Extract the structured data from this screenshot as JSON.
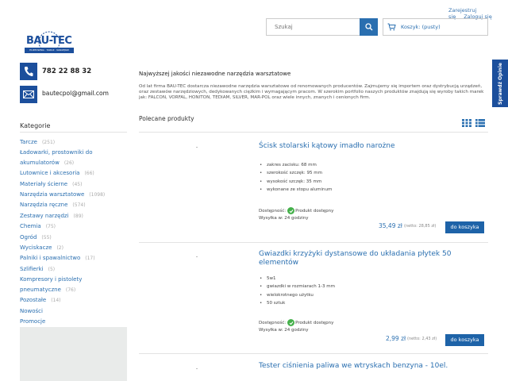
{
  "header": {
    "register": "Zarejestruj się",
    "login": "Zaloguj się",
    "search_placeholder": "Szukaj",
    "cart_label": "Koszyk: (pusty)"
  },
  "logo": {
    "name": "BAU-TEC",
    "tagline": "HURTOWNIA · TARCZ · NARZĘDZI"
  },
  "contact": {
    "phone": "782 22 88 32",
    "email": "bautecpol@gmail.com"
  },
  "sidebar": {
    "title": "Kategorie",
    "items": [
      {
        "label": "Tarcze",
        "count": "(251)"
      },
      {
        "label": "Ładowarki, prostowniki do akumulatorów",
        "count": "(26)"
      },
      {
        "label": "Lutownice i akcesoria",
        "count": "(66)"
      },
      {
        "label": "Materiały ścierne",
        "count": "(45)"
      },
      {
        "label": "Narzędzia warsztatowe",
        "count": "(1098)"
      },
      {
        "label": "Narzędzia ręczne",
        "count": "(574)"
      },
      {
        "label": "Zestawy narzędzi",
        "count": "(89)"
      },
      {
        "label": "Chemia",
        "count": "(75)"
      },
      {
        "label": "Ogród",
        "count": "(55)"
      },
      {
        "label": "Wyciskacze",
        "count": "(2)"
      },
      {
        "label": "Palniki i spawalnictwo",
        "count": "(17)"
      },
      {
        "label": "Szlifierki",
        "count": "(5)"
      },
      {
        "label": "Kompresory i pistolety pneumatyczne",
        "count": "(76)"
      },
      {
        "label": "Pozostałe",
        "count": "(14)"
      },
      {
        "label": "Nowości",
        "count": ""
      },
      {
        "label": "Promocje",
        "count": ""
      }
    ]
  },
  "intro": {
    "title": "Najwyższej jakości niezawodne narzędzia warsztatowe",
    "text": "Od lat firma BAU-TEC dostarcza niezawodne narzędzia warsztatowe od renomowanych producentów. Zajmujemy się importem oraz dystrybucją urządzeń, oraz zestawów narzędziowych, dedykowanych ciężkim i wymagającym pracom. W szerokim portfolio naszych produktów znajdują się wyroby takich marek jak: FALCON, VORFAL, HONITON, TEDIAM, SILVER, MAR-POL oraz wiele innych, znanych i cenionych firm."
  },
  "featured": {
    "title": "Polecane produkty"
  },
  "products": [
    {
      "name": "Ścisk stolarski kątowy imadło narożne",
      "features": [
        "zakres zacisku: 68 mm",
        "szerokość szczęk: 95 mm",
        "wysokość szczęk: 35 mm",
        "wykonane ze stopu aluminum"
      ],
      "availability_label": "Dostępność:",
      "availability": "Produkt dostępny",
      "shipping": "Wysyłka w: 24 godziny",
      "price": "35,49 zł",
      "net_price": "(netto: 28,85 zł)",
      "cart_button": "do koszyka"
    },
    {
      "name": "Gwiazdki krzyżyki dystansowe do układania płytek 50 elementów",
      "features": [
        "5w1",
        "gwiazdki w rozmiarach 1-3 mm",
        "wielokrotnego użytku",
        "50 sztuk"
      ],
      "availability_label": "Dostępność:",
      "availability": "Produkt dostępny",
      "shipping": "Wysyłka w: 24 godziny",
      "price": "2,99 zł",
      "net_price": "(netto: 2,43 zł)",
      "cart_button": "do koszyka"
    },
    {
      "name": "Tester ciśnienia paliwa we wtryskach benzyna - 10el."
    }
  ],
  "side_tab": {
    "label": "Sprawdź Opinie"
  }
}
